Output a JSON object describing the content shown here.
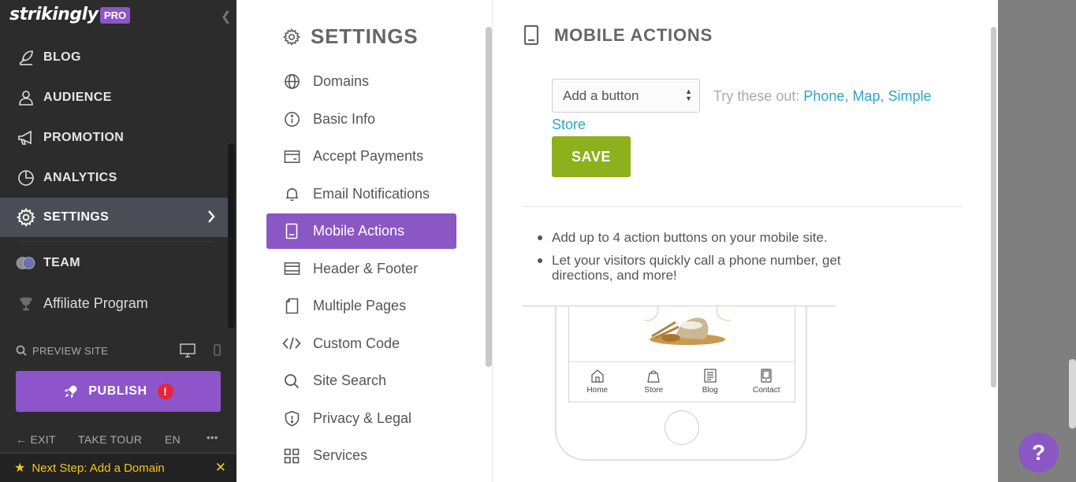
{
  "brand": {
    "logo": "strikingly",
    "badge": "PRO"
  },
  "sidebar": {
    "items": [
      {
        "label": "BLOG",
        "icon": "feather-icon"
      },
      {
        "label": "AUDIENCE",
        "icon": "users-icon"
      },
      {
        "label": "PROMOTION",
        "icon": "megaphone-icon"
      },
      {
        "label": "ANALYTICS",
        "icon": "pie-chart-icon"
      },
      {
        "label": "SETTINGS",
        "icon": "gear-icon",
        "active": true
      }
    ],
    "team_label": "TEAM",
    "affiliate_label": "Affiliate Program",
    "preview_label": "PREVIEW SITE",
    "publish_label": "PUBLISH",
    "publish_alert": "!",
    "bottom": {
      "exit": "EXIT",
      "tour": "TAKE TOUR",
      "lang": "EN",
      "more": "•••"
    },
    "next_step": "Next Step: Add a Domain"
  },
  "settings": {
    "title": "SETTINGS",
    "nav": [
      {
        "label": "Domains",
        "icon": "globe-icon"
      },
      {
        "label": "Basic Info",
        "icon": "info-icon"
      },
      {
        "label": "Accept Payments",
        "icon": "card-icon"
      },
      {
        "label": "Email Notifications",
        "icon": "bell-icon"
      },
      {
        "label": "Mobile Actions",
        "icon": "mobile-icon",
        "active": true
      },
      {
        "label": "Header & Footer",
        "icon": "layout-icon"
      },
      {
        "label": "Multiple Pages",
        "icon": "page-icon"
      },
      {
        "label": "Custom Code",
        "icon": "code-icon"
      },
      {
        "label": "Site Search",
        "icon": "search-icon"
      },
      {
        "label": "Privacy & Legal",
        "icon": "shield-icon"
      },
      {
        "label": "Services",
        "icon": "grid-icon"
      }
    ]
  },
  "mobile_actions": {
    "title": "MOBILE ACTIONS",
    "select_value": "Add a button",
    "try_prefix": "Try these out: ",
    "suggestions": "Phone, Map, Simple",
    "suggestions_cont": "Store",
    "save_label": "SAVE",
    "bullets": [
      "Add up to 4 action buttons on your mobile site.",
      "Let your visitors quickly call a phone number, get directions, and more!"
    ],
    "phone_tabs": [
      "Home",
      "Store",
      "Blog",
      "Contact"
    ]
  },
  "help_label": "?",
  "colors": {
    "purple": "#8a57c5",
    "save_green": "#8cb11c",
    "link": "#2aa7c9",
    "sidebar_bg": "#2c2c2c"
  }
}
